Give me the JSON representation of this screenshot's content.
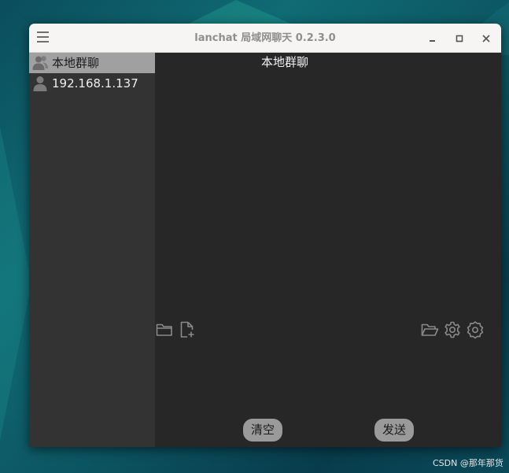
{
  "window": {
    "title": "lanchat  局域网聊天  0.2.3.0",
    "controls": {
      "minimize": "minimize-icon",
      "maximize": "maximize-icon",
      "close": "close-icon"
    }
  },
  "sidebar": {
    "items": [
      {
        "label": "本地群聊",
        "icon": "group-users-icon",
        "selected": true
      },
      {
        "label": "192.168.1.137",
        "icon": "user-icon",
        "selected": false
      }
    ]
  },
  "chat": {
    "title": "本地群聊",
    "left_tools": [
      "folder-icon",
      "new-file-icon"
    ],
    "right_tools": [
      "folder-open-icon",
      "gear-icon",
      "settings-badge-icon"
    ],
    "clear_label": "清空",
    "send_label": "发送"
  },
  "watermark": "CSDN @那年那货",
  "colors": {
    "sidebar_bg": "#333333",
    "chat_bg": "#272727",
    "selected_item_bg": "#a0a0a0",
    "button_bg": "#9a9a9a",
    "titlebar_bg": "#f6f5f4"
  }
}
